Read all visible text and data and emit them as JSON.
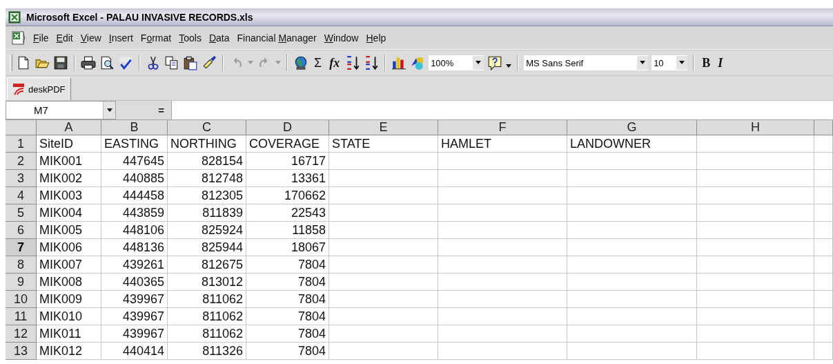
{
  "window": {
    "title": "Microsoft Excel - PALAU INVASIVE RECORDS.xls"
  },
  "menu": [
    {
      "key": "F",
      "after": "ile"
    },
    {
      "key": "E",
      "after": "dit"
    },
    {
      "key": "V",
      "after": "iew"
    },
    {
      "key": "I",
      "after": "nsert"
    },
    {
      "before": "F",
      "key": "o",
      "after": "rmat"
    },
    {
      "key": "T",
      "after": "ools"
    },
    {
      "key": "D",
      "after": "ata"
    },
    {
      "before": "Financial ",
      "key": "M",
      "after": "anager"
    },
    {
      "key": "W",
      "after": "indow"
    },
    {
      "key": "H",
      "after": "elp"
    }
  ],
  "toolbar": {
    "sum_button": "Σ",
    "function_button": "fx",
    "zoom": "100%",
    "font": "MS Sans Serif",
    "font_size": "10",
    "bold_button": "B",
    "italic_button": "I"
  },
  "pdf_toolbar": {
    "button": "deskPDF"
  },
  "formula_bar": {
    "name_box": "M7",
    "equals": "="
  },
  "sheet": {
    "columns": [
      {
        "letter": "A"
      },
      {
        "letter": "B"
      },
      {
        "letter": "C"
      },
      {
        "letter": "D"
      },
      {
        "letter": "E"
      },
      {
        "letter": "F"
      },
      {
        "letter": "G"
      },
      {
        "letter": "H"
      }
    ],
    "rows": [
      {
        "number": "1",
        "kind": "labels",
        "selected": false,
        "cells": [
          "SiteID",
          "EASTING",
          "NORTHING",
          "COVERAGE",
          "STATE",
          "HAMLET",
          "LANDOWNER"
        ]
      },
      {
        "number": "2",
        "kind": "record",
        "selected": false,
        "cells": [
          "MIK001",
          "447645",
          "828154",
          "16717"
        ]
      },
      {
        "number": "3",
        "kind": "record",
        "selected": false,
        "cells": [
          "MIK002",
          "440885",
          "812748",
          "13361"
        ]
      },
      {
        "number": "4",
        "kind": "record",
        "selected": false,
        "cells": [
          "MIK003",
          "444458",
          "812305",
          "170662"
        ]
      },
      {
        "number": "5",
        "kind": "record",
        "selected": false,
        "cells": [
          "MIK004",
          "443859",
          "811839",
          "22543"
        ]
      },
      {
        "number": "6",
        "kind": "record",
        "selected": false,
        "cells": [
          "MIK005",
          "448106",
          "825924",
          "11858"
        ]
      },
      {
        "number": "7",
        "kind": "record",
        "selected": true,
        "cells": [
          "MIK006",
          "448136",
          "825944",
          "18067"
        ]
      },
      {
        "number": "8",
        "kind": "record",
        "selected": false,
        "cells": [
          "MIK007",
          "439261",
          "812675",
          "7804"
        ]
      },
      {
        "number": "9",
        "kind": "record",
        "selected": false,
        "cells": [
          "MIK008",
          "440365",
          "813012",
          "7804"
        ]
      },
      {
        "number": "10",
        "kind": "record",
        "selected": false,
        "cells": [
          "MIK009",
          "439967",
          "811062",
          "7804"
        ]
      },
      {
        "number": "11",
        "kind": "record",
        "selected": false,
        "cells": [
          "MIK010",
          "439967",
          "811062",
          "7804"
        ]
      },
      {
        "number": "12",
        "kind": "record",
        "selected": false,
        "cells": [
          "MIK011",
          "439967",
          "811062",
          "7804"
        ]
      },
      {
        "number": "13",
        "kind": "record",
        "selected": false,
        "cells": [
          "MIK012",
          "440414",
          "811326",
          "7804"
        ]
      }
    ]
  }
}
